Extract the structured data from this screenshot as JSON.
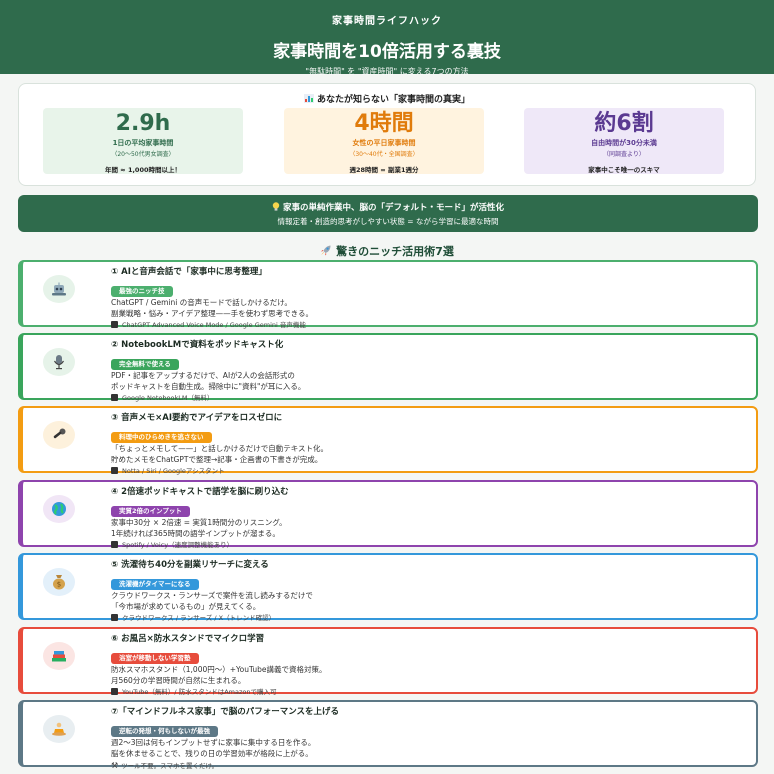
{
  "header": {
    "kicker": "家事時間ライフハック",
    "title": "家事時間を10倍活用する裏技",
    "subtitle": "\"無駄時間\" を \"資産時間\" に変える7つの方法"
  },
  "truth": {
    "title": "あなたが知らない「家事時間の真実」",
    "stats": [
      {
        "big": "2.9h",
        "label": "1日の平均家事時間",
        "sub": "（20〜50代男女調査）",
        "note": "年間 ≈ 1,000時間以上！"
      },
      {
        "big": "4時間",
        "label": "女性の平日家事時間",
        "sub": "（30〜40代・全国調査）",
        "note": "週28時間 = 副業1週分"
      },
      {
        "big": "約6割",
        "label": "自由時間が30分未満",
        "sub": "（同調査より）",
        "note": "家事中こそ唯一のスキマ"
      }
    ]
  },
  "banner": {
    "main": "家事の単純作業中、脳の「デフォルト・モード」が活性化",
    "sub": "情報定着・創造的思考がしやすい状態 = ながら学習に最適な時間"
  },
  "section_title": "驚きのニッチ活用術7選",
  "colors": {
    "green": "#4caf6e",
    "teal": "#3aa55c",
    "orange": "#f39c12",
    "purple": "#8e44ad",
    "blue": "#3498db",
    "red": "#e74c3c",
    "slate": "#5d7886"
  },
  "cards": [
    {
      "title": "① AIと音声会話で「家事中に思考整理」",
      "badge": "最強のニッチ技",
      "desc1": "ChatGPT / Gemini の音声モードで話しかけるだけ。",
      "desc2": "副業戦略・悩み・アイデア整理——手を使わず思考できる。",
      "tools": "ChatGPT Advanced Voice Mode / Google Gemini 音声機能",
      "icon": "robot-icon"
    },
    {
      "title": "② NotebookLMで資料をポッドキャスト化",
      "badge": "完全無料で使える",
      "desc1": "PDF・記事をアップするだけで、AIが2人の会話形式の",
      "desc2": "ポッドキャストを自動生成。掃除中に\"資料\"が耳に入る。",
      "tools": "Google NotebookLM（無料）",
      "icon": "microphone-icon"
    },
    {
      "title": "③ 音声メモ×AI要約でアイデアをロスゼロに",
      "badge": "料理中のひらめきを逃さない",
      "desc1": "「ちょっとメモして——」と話しかけるだけで自動テキスト化。",
      "desc2": "貯めたメモをChatGPTで整理→記事・企画書の下書きが完成。",
      "tools": "Notta / Siri / Googleアシスタント",
      "icon": "handheld-mic-icon"
    },
    {
      "title": "④ 2倍速ポッドキャストで語学を脳に刷り込む",
      "badge": "実質2倍のインプット",
      "desc1": "家事中30分 × 2倍速 = 実質1時間分のリスニング。",
      "desc2": "1年続ければ365時間の語学インプットが溜まる。",
      "tools": "Spotify / Voicy（速度調整機能あり）",
      "icon": "globe-icon"
    },
    {
      "title": "⑤ 洗濯待ち40分を副業リサーチに変える",
      "badge": "洗濯機がタイマーになる",
      "desc1": "クラウドワークス・ランサーズで案件を流し読みするだけで",
      "desc2": "「今市場が求めているもの」が見えてくる。",
      "tools": "クラウドワークス / ランサーズ / X（トレンド確認）",
      "icon": "money-bag-icon"
    },
    {
      "title": "⑥ お風呂×防水スタンドでマイクロ学習",
      "badge": "浴室が移動しない学習塾",
      "desc1": "防水スマホスタンド（1,000円〜）+YouTube講義で資格対策。",
      "desc2": "月560分の学習時間が自然に生まれる。",
      "tools": "YouTube（無料）/ 防水スタンドはAmazonで購入可",
      "icon": "books-icon"
    },
    {
      "title": "⑦「マインドフルネス家事」で脳のパフォーマンスを上げる",
      "badge": "逆転の発想・何もしないが最強",
      "desc1": "週2〜3回は何もインプットせずに家事に集中する日を作る。",
      "desc2": "脳を休ませることで、残りの日の学習効率が格段に上がる。",
      "tools": "ツール不要。スマホを置くだけ。",
      "icon": "meditation-icon"
    }
  ]
}
